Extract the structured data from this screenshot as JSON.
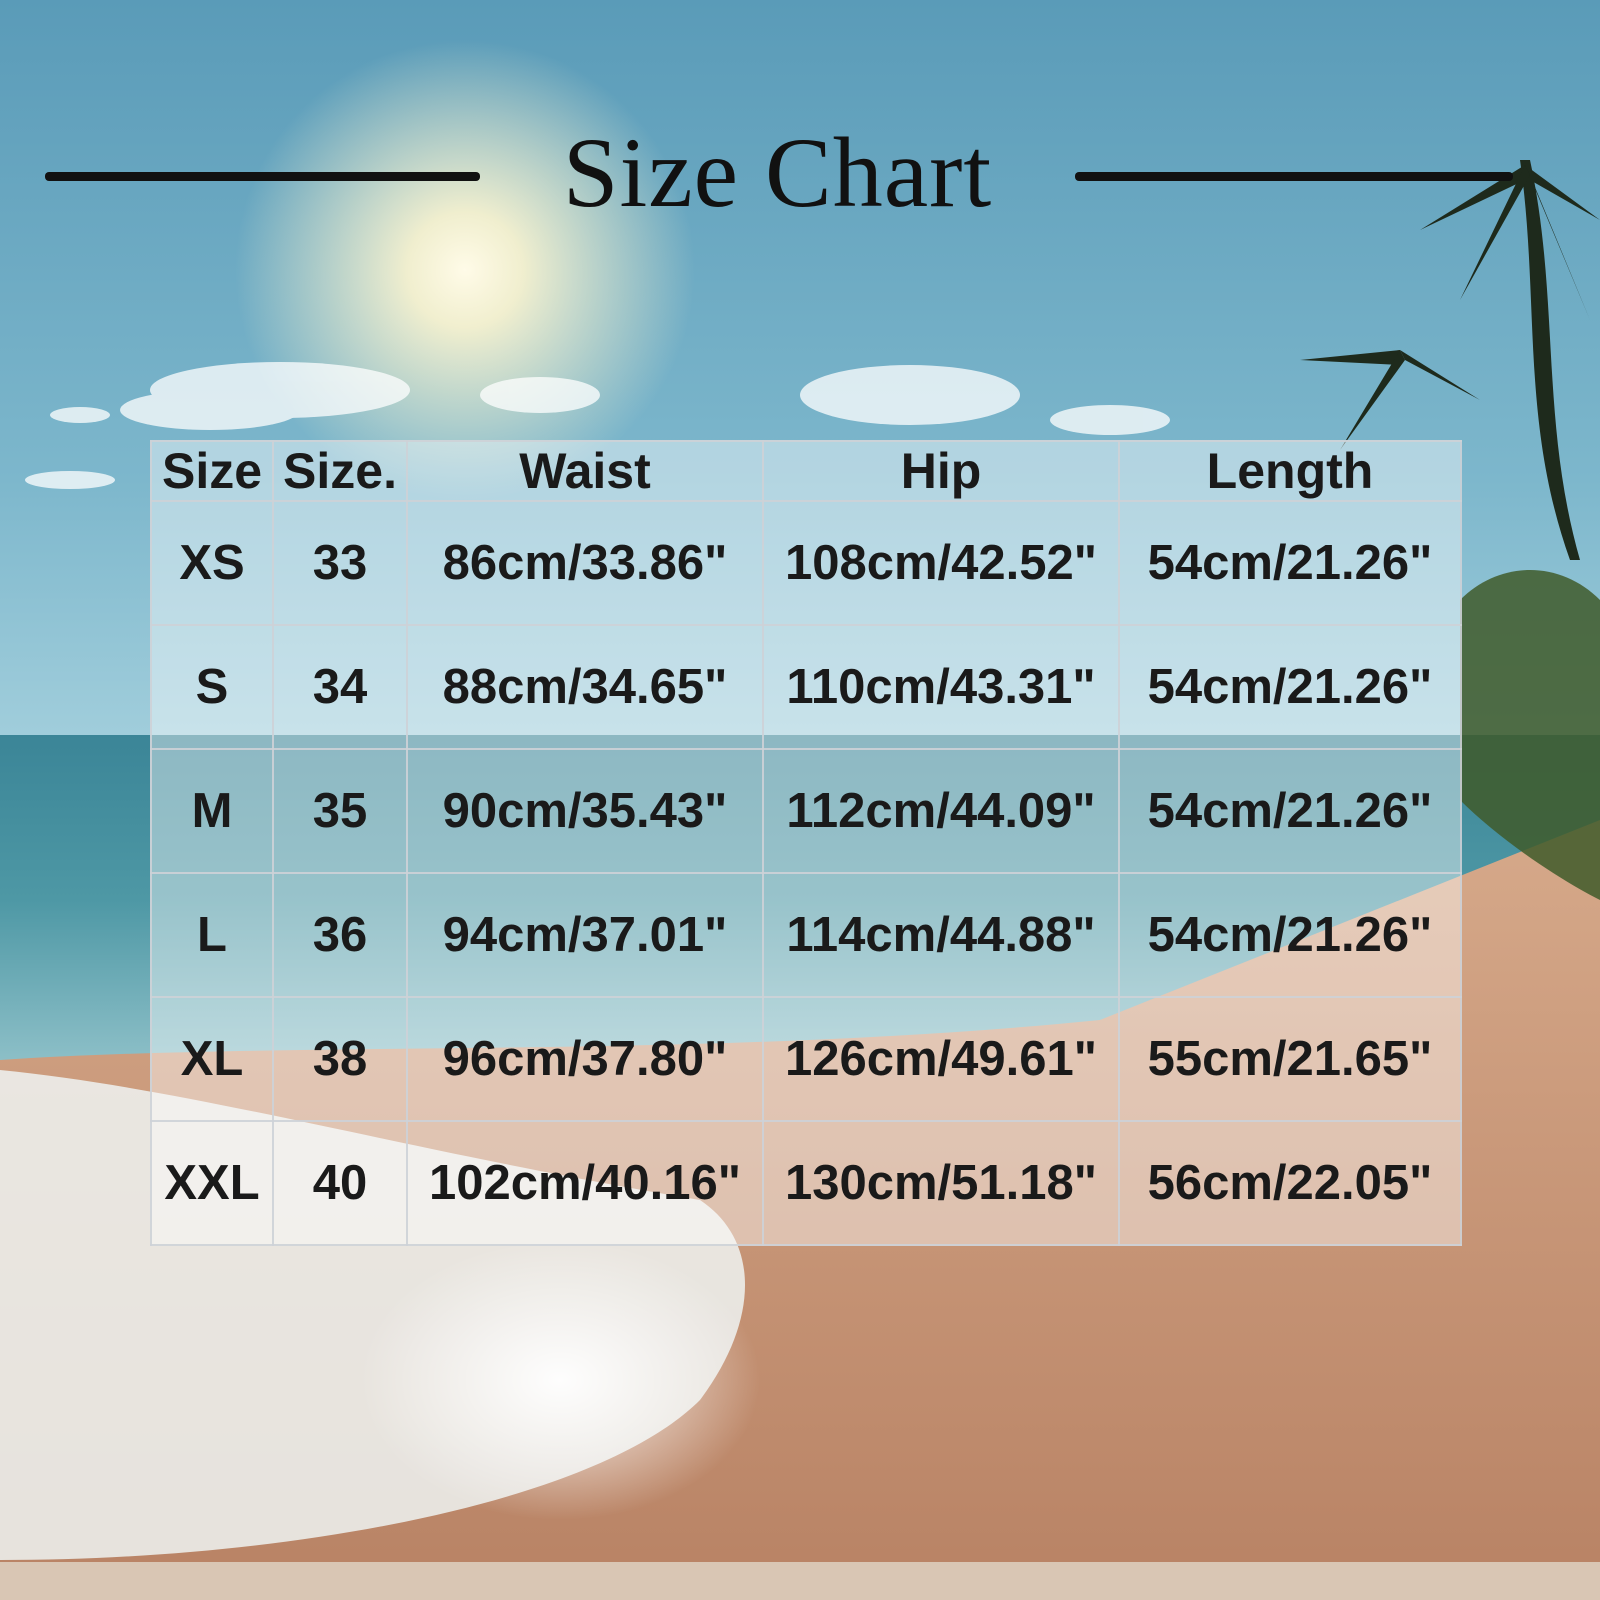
{
  "title": "Size Chart",
  "table": {
    "headers": [
      "Size",
      "Size.",
      "Waist",
      "Hip",
      "Length"
    ],
    "rows": [
      [
        "XS",
        "33",
        "86cm/33.86\"",
        "108cm/42.52\"",
        "54cm/21.26\""
      ],
      [
        "S",
        "34",
        "88cm/34.65\"",
        "110cm/43.31\"",
        "54cm/21.26\""
      ],
      [
        "M",
        "35",
        "90cm/35.43\"",
        "112cm/44.09\"",
        "54cm/21.26\""
      ],
      [
        "L",
        "36",
        "94cm/37.01\"",
        "114cm/44.88\"",
        "54cm/21.26\""
      ],
      [
        "XL",
        "38",
        "96cm/37.80\"",
        "126cm/49.61\"",
        "55cm/21.65\""
      ],
      [
        "XXL",
        "40",
        "102cm/40.16\"",
        "130cm/51.18\"",
        "56cm/22.05\""
      ]
    ]
  }
}
